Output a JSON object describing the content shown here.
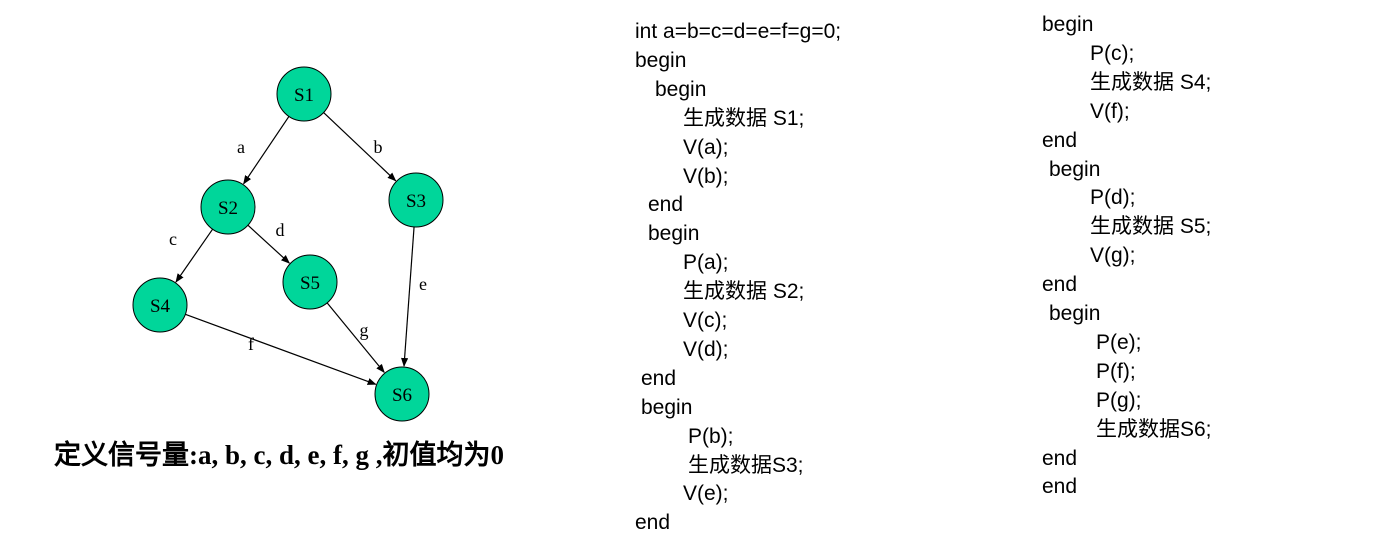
{
  "nodes": [
    {
      "id": "S1",
      "label": "S1"
    },
    {
      "id": "S2",
      "label": "S2"
    },
    {
      "id": "S3",
      "label": "S3"
    },
    {
      "id": "S4",
      "label": "S4"
    },
    {
      "id": "S5",
      "label": "S5"
    },
    {
      "id": "S6",
      "label": "S6"
    }
  ],
  "edges": [
    {
      "from": "S1",
      "to": "S2",
      "label": "a"
    },
    {
      "from": "S1",
      "to": "S3",
      "label": "b"
    },
    {
      "from": "S2",
      "to": "S4",
      "label": "c"
    },
    {
      "from": "S2",
      "to": "S5",
      "label": "d"
    },
    {
      "from": "S3",
      "to": "S6",
      "label": "e"
    },
    {
      "from": "S4",
      "to": "S6",
      "label": "f"
    },
    {
      "from": "S5",
      "to": "S6",
      "label": "g"
    }
  ],
  "colors": {
    "node_fill": "#00d69a",
    "node_stroke": "#000000",
    "edge": "#000000"
  },
  "caption": "定义信号量:a, b, c, d, e, f, g ,初值均为0",
  "code_left": [
    "int a=b=c=d=e=f=g=0;",
    "begin",
    "begin",
    "生成数据 S1;",
    "V(a);",
    "V(b);",
    "end",
    "begin",
    "P(a);",
    "生成数据 S2;",
    "V(c);",
    "V(d);",
    "end",
    "begin",
    "P(b);",
    "生成数据S3;",
    "V(e);",
    "end"
  ],
  "code_right": [
    "begin",
    "P(c);",
    "生成数据 S4;",
    "V(f);",
    "end",
    "begin",
    "P(d);",
    "生成数据 S5;",
    "V(g);",
    "end",
    "begin",
    "P(e);",
    "P(f);",
    "P(g);",
    "生成数据S6;",
    "end",
    "end"
  ]
}
